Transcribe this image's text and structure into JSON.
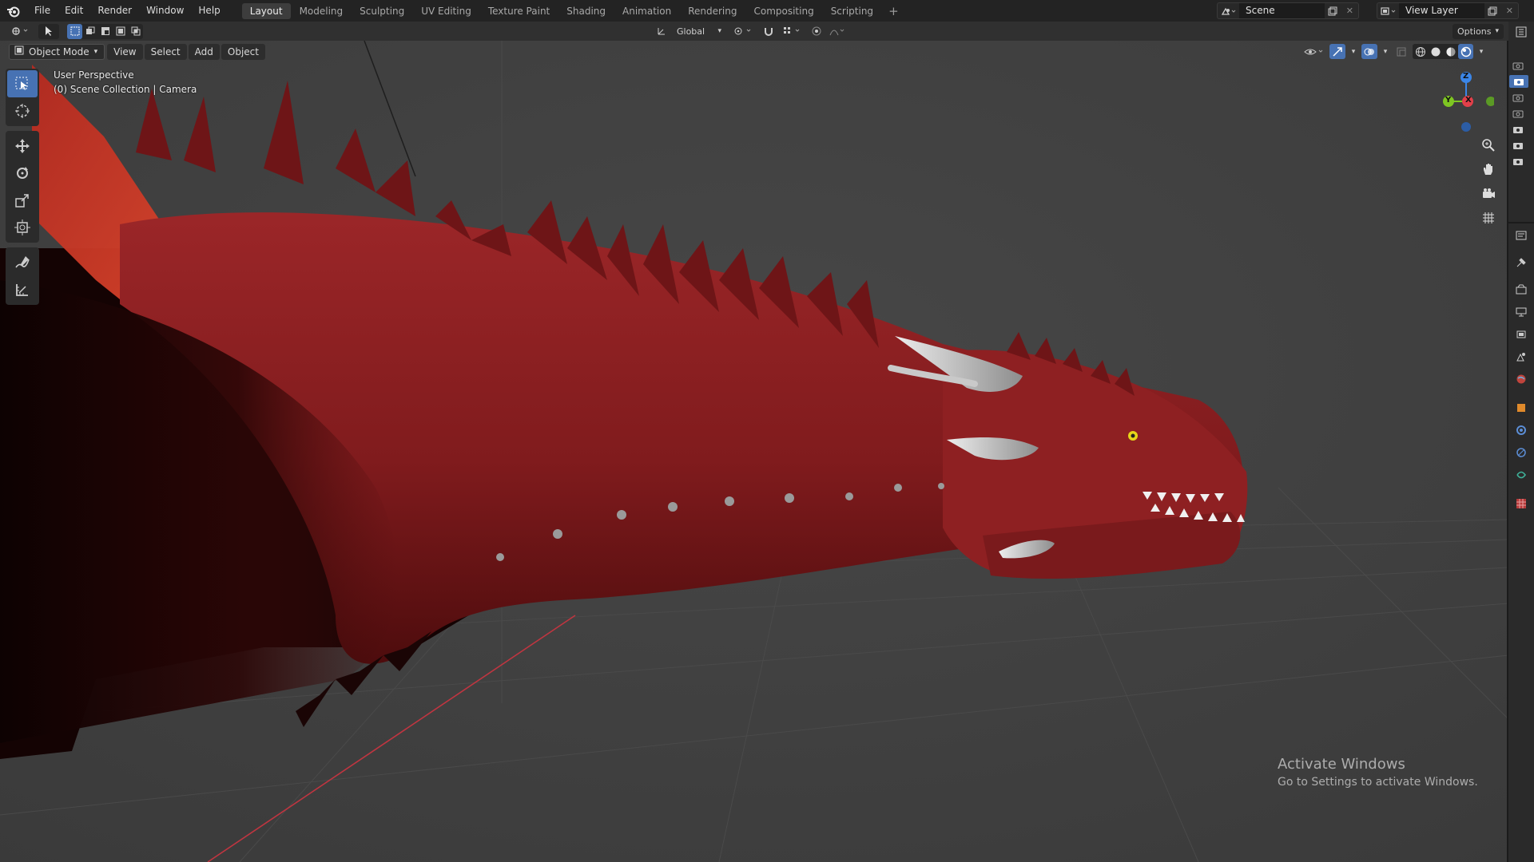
{
  "menu": {
    "items": [
      "File",
      "Edit",
      "Render",
      "Window",
      "Help"
    ]
  },
  "workspaces": {
    "tabs": [
      "Layout",
      "Modeling",
      "Sculpting",
      "UV Editing",
      "Texture Paint",
      "Shading",
      "Animation",
      "Rendering",
      "Compositing",
      "Scripting"
    ],
    "active": "Layout",
    "add_label": "+"
  },
  "scene": {
    "name": "Scene"
  },
  "view_layer": {
    "name": "View Layer"
  },
  "tool_settings": {
    "orientation": "Global",
    "options_label": "Options"
  },
  "viewport_header": {
    "mode": "Object Mode",
    "menus": [
      "View",
      "Select",
      "Add",
      "Object"
    ]
  },
  "viewport": {
    "perspective_label": "User Perspective",
    "collection_label": "(0) Scene Collection | Camera"
  },
  "gizmo": {
    "axis_z": "Z",
    "axis_y": "Y",
    "axis_x": "X"
  },
  "watermark": {
    "title": "Activate Windows",
    "subtitle": "Go to Settings to activate Windows."
  },
  "colors": {
    "accent": "#4772b3",
    "viewport_bg": "#3f3f3f",
    "dragon": "#8a1d1f",
    "axis_x": "#e2404a",
    "axis_y": "#7ec622",
    "axis_z": "#3b86e8"
  },
  "icons": {
    "toolbar": [
      "select-box-icon",
      "cursor-icon",
      "move-icon",
      "rotate-icon",
      "scale-icon",
      "transform-icon",
      "annotate-icon",
      "measure-icon"
    ],
    "nav": [
      "zoom-icon",
      "pan-hand-icon",
      "camera-view-icon",
      "ortho-grid-icon"
    ],
    "properties": [
      "tool-icon",
      "render-icon",
      "output-icon",
      "view-layer-icon",
      "scene-icon",
      "world-icon",
      "object-icon",
      "modifier-icon",
      "physics-icon",
      "constraint-icon",
      "data-icon",
      "texture-icon"
    ]
  }
}
